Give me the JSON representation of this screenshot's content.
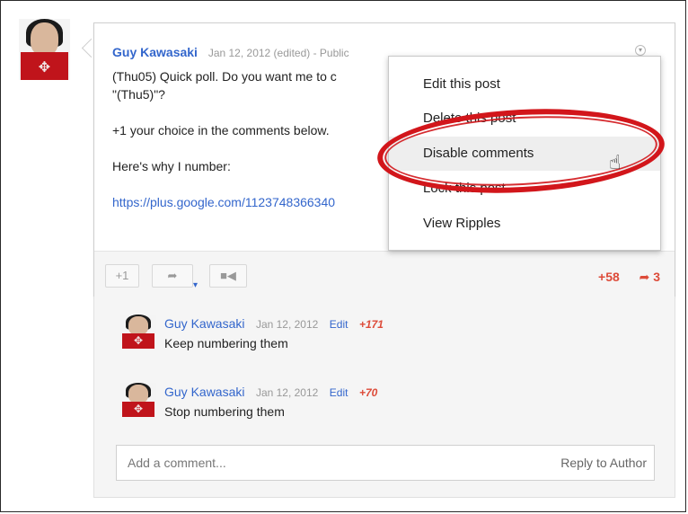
{
  "post": {
    "author": "Guy Kawasaki",
    "meta": "Jan 12, 2012 (edited)  -  Public",
    "lines": [
      "(Thu05) Quick poll. Do you want me to c",
      "\"(Thu5)\"?",
      "",
      "+1 your choice in the comments below.",
      "",
      "Here's why I number:",
      ""
    ],
    "link": "https://plus.google.com/1123748366340"
  },
  "menu": {
    "items": [
      "Edit this post",
      "Delete this post",
      "Disable comments",
      "Lock this post",
      "View Ripples"
    ]
  },
  "toolbar": {
    "plus_one": "+1",
    "plus_count": "+58",
    "share_count": "3"
  },
  "comments": [
    {
      "author": "Guy Kawasaki",
      "date": "Jan 12, 2012",
      "edit": "Edit",
      "plus": "+171",
      "text": "Keep numbering them"
    },
    {
      "author": "Guy Kawasaki",
      "date": "Jan 12, 2012",
      "edit": "Edit",
      "plus": "+70",
      "text": "Stop numbering them"
    }
  ],
  "comment_box": {
    "placeholder": "Add a comment...",
    "reply": "Reply to Author"
  },
  "icons": {
    "share": "share-arrow-icon",
    "video": "video-camera-icon",
    "menu": "chevron-down-icon",
    "cursor": "hand-pointer-icon"
  },
  "colors": {
    "link": "#3366cc",
    "accent_red": "#dd4b39",
    "highlight": "#d2161b"
  }
}
